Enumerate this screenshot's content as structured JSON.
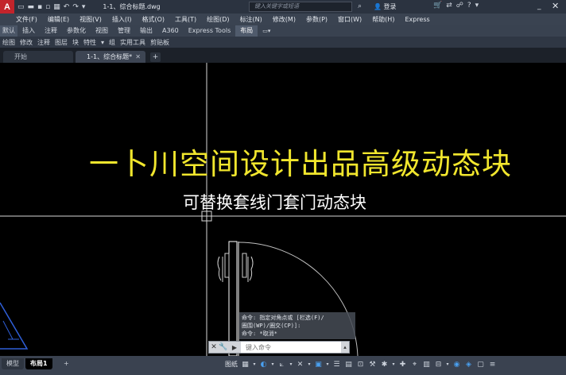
{
  "app": {
    "logo_text": "A",
    "document_title": "1-1、综合标题.dwg",
    "search_placeholder": "键入关键字或短语",
    "login_label": "登录",
    "help_label": "?",
    "minimize_label": "_",
    "close_label": "✕"
  },
  "menu": [
    "文件(F)",
    "编辑(E)",
    "视图(V)",
    "插入(I)",
    "格式(O)",
    "工具(T)",
    "绘图(D)",
    "标注(N)",
    "修改(M)",
    "参数(P)",
    "窗口(W)",
    "帮助(H)",
    "Express"
  ],
  "ribbon_tabs": [
    "默认",
    "插入",
    "注释",
    "参数化",
    "视图",
    "管理",
    "输出",
    "A360",
    "Express Tools",
    "布局"
  ],
  "ribbon_active_tab": "布局",
  "panels": [
    "绘图",
    "修改",
    "注释",
    "图层",
    "块",
    "特性",
    "▾",
    "组",
    "实用工具",
    "剪贴板"
  ],
  "file_tabs": [
    {
      "label": "开始"
    },
    {
      "label": "1-1、综合标题*",
      "close": "✕"
    }
  ],
  "file_tab_add": "+",
  "canvas": {
    "main_title": "一卜川空间设计出品高级动态块",
    "sub_title": "可替换套线门套门动态块",
    "main_title_color": "#f1e62d",
    "sub_title_color": "#ffffff"
  },
  "command": {
    "history": [
      "命令: 指定对角点或 [栏选(F)/",
      "圈围(WP)/圈交(CP)]:",
      "命令: *取消*"
    ],
    "prompt_placeholder": "键入命令",
    "close_icon": "✕",
    "tool_icon": "🔧",
    "prompt_icon": "▶",
    "dropdown_icon": "▴"
  },
  "layout_tabs": [
    "模型",
    "布局1",
    "+"
  ],
  "layout_active": "布局1",
  "status": {
    "model_label": "图纸"
  }
}
